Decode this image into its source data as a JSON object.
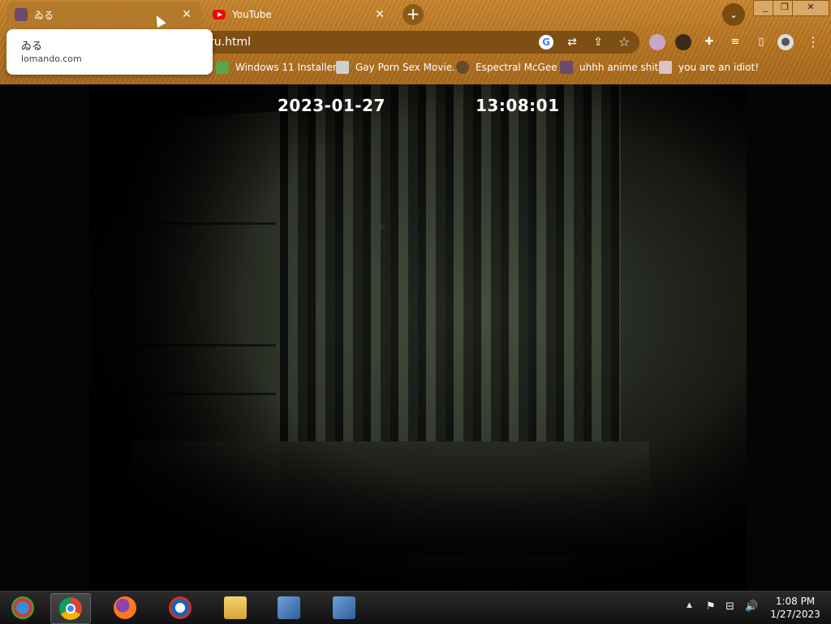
{
  "browser": {
    "tabs": [
      {
        "title": "ゐる",
        "icon": "anime-avatar-icon",
        "active": true
      },
      {
        "title": "YouTube",
        "icon": "youtube-icon",
        "active": false
      }
    ],
    "new_tab_label": "+",
    "tab_search_label": "⌄",
    "window_controls": {
      "minimize": "_",
      "maximize": "❐",
      "close": "✕"
    },
    "address": {
      "url_fragment": "ru.html"
    },
    "hover_card": {
      "title": "ゐる",
      "domain": "lomando.com"
    },
    "bookmarks": [
      {
        "label": "Windows 11 Installer",
        "icon": "installer-icon"
      },
      {
        "label": "Gay Porn Sex Movie...",
        "icon": "disk-icon"
      },
      {
        "label": "Espectral McGee",
        "icon": "face-icon"
      },
      {
        "label": "uhhh anime shit",
        "icon": "anime-avatar-icon"
      },
      {
        "label": "you are an idiot!",
        "icon": "flag-icon"
      }
    ]
  },
  "video": {
    "date_stamp": "2023-01-27",
    "time_stamp": "13:08:01"
  },
  "taskbar": {
    "apps": [
      "start-orb-icon",
      "chrome-icon",
      "firefox-icon",
      "internet-explorer-icon",
      "file-explorer-icon",
      "network-app-icon",
      "network-app-icon"
    ],
    "clock_time": "1:08 PM",
    "clock_date": "1/27/2023"
  },
  "colors": {
    "chrome_accent": "#b5731f",
    "omnibox": "#7d4f12"
  }
}
